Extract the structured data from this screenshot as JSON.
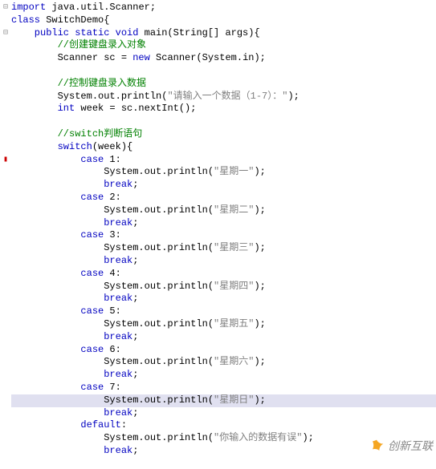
{
  "code": {
    "l1_import": "import",
    "l1_pkg": " java.util.Scanner;",
    "l2_class": "class",
    "l2_name": " SwitchDemo{",
    "l3_mods": "    public static void",
    "l3_main": " main(String[] args){",
    "c1": "        //创建键盘录入对象",
    "l4a": "        Scanner sc = ",
    "l4new": "new",
    "l4b": " Scanner(System.in);",
    "blank": "",
    "c2": "        //控制键盘录入数据",
    "l5a": "        System.out.println(",
    "l5s": "\"请输入一个数据（1-7）：\"",
    "l5b": ");",
    "l6_int": "        int",
    "l6_rest": " week = sc.nextInt();",
    "c3": "        //switch判断语句",
    "l7_sw": "        switch",
    "l7_rest": "(week){",
    "case_kw": "            case",
    "case1": " 1:",
    "p1a": "                System.out.println(",
    "p1s": "\"星期一\"",
    "p1b": ");",
    "brk": "                break",
    "semi": ";",
    "case2": " 2:",
    "p2s": "\"星期二\"",
    "case3": " 3:",
    "p3s": "\"星期三\"",
    "case4": " 4:",
    "p4s": "\"星期四\"",
    "case5": " 5:",
    "p5s": "\"星期五\"",
    "case6": " 6:",
    "p6s": "\"星期六\"",
    "case7": " 7:",
    "p7s": "\"星期日\"",
    "def_kw": "            default",
    "def_colon": ":",
    "pds": "\"你输入的数据有误\"",
    "gutter_collapse": "⊟",
    "gutter_mark": "▮"
  },
  "watermark": {
    "text": "创新互联"
  }
}
